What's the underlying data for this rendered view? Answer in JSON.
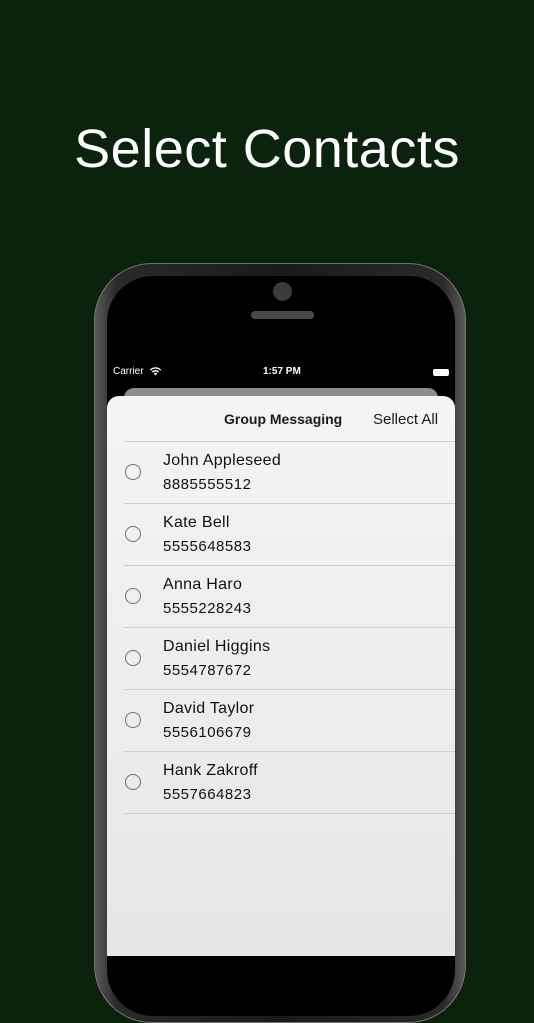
{
  "headline": "Select Contacts",
  "status_bar": {
    "carrier": "Carrier",
    "time": "1:57 PM",
    "wifi_icon": "wifi-icon",
    "battery_icon": "battery-icon"
  },
  "nav": {
    "title": "Group Messaging",
    "select_all_label": "Sellect All"
  },
  "contacts": [
    {
      "name": "John Appleseed",
      "phone": "8885555512"
    },
    {
      "name": "Kate Bell",
      "phone": "5555648583"
    },
    {
      "name": "Anna Haro",
      "phone": "5555228243"
    },
    {
      "name": "Daniel Higgins",
      "phone": "5554787672"
    },
    {
      "name": "David Taylor",
      "phone": "5556106679"
    },
    {
      "name": "Hank Zakroff",
      "phone": "5557664823"
    }
  ],
  "colors": {
    "background": "#0b220d",
    "sheet": "#efefef",
    "text": "#111111"
  }
}
